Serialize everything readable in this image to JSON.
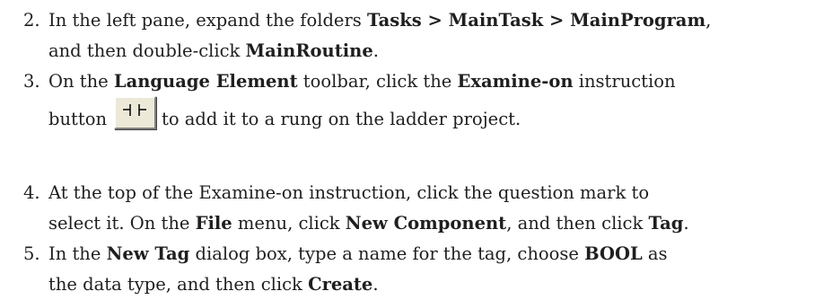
{
  "steps": [
    {
      "number": "2.",
      "line1_a": "In the left pane, expand the folders ",
      "line1_b": "Tasks > MainTask > MainProgram",
      "line1_c": ",",
      "line2_a": "and then double-click ",
      "line2_b": "MainRoutine",
      "line2_c": "."
    },
    {
      "number": "3.",
      "line1_a": "On the ",
      "line1_b": "Language Element",
      "line1_c": " toolbar, click the ",
      "line1_d": "Examine-on",
      "line1_e": " instruction",
      "line2_a": "button",
      "line2_b": "to add it to a rung on the ladder project.",
      "icon": "examine-on-instruction-icon"
    },
    {
      "number": "4.",
      "line1": "At the top of the Examine-on instruction, click the question mark to",
      "line2_a": "select it. On the ",
      "line2_b": "File",
      "line2_c": " menu, click ",
      "line2_d": "New Component",
      "line2_e": ", and then click ",
      "line2_f": "Tag",
      "line2_g": "."
    },
    {
      "number": "5.",
      "line1_a": "In the ",
      "line1_b": "New Tag",
      "line1_c": " dialog box, type a name for the tag, choose ",
      "line1_d": "BOOL",
      "line1_e": " as",
      "line2_a": "the data type, and then click ",
      "line2_b": "Create",
      "line2_c": "."
    }
  ]
}
